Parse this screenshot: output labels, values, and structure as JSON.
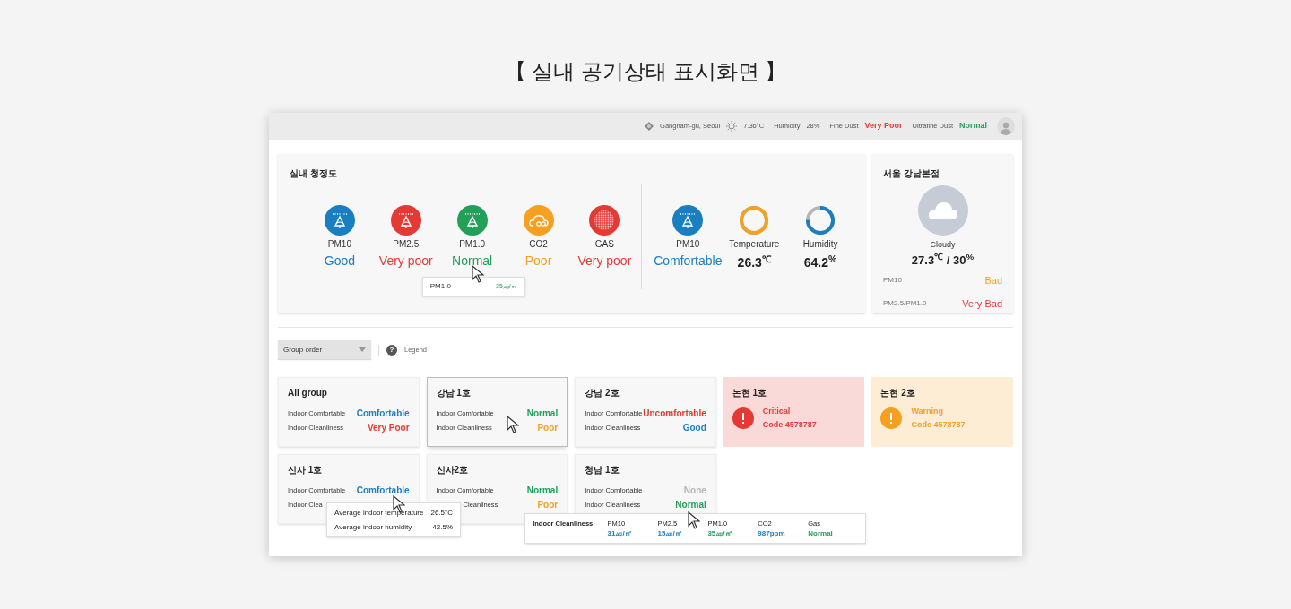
{
  "page_title": "【 실내 공기상태 표시화면 】",
  "top_bar": {
    "location": "Gangnam-gu, Seoul",
    "temperature": "7.36°C",
    "humidity_label": "Humidity",
    "humidity": "28%",
    "fine_dust_label": "Fine Dust",
    "fine_dust": {
      "value": "Very Poor",
      "color": "#e53935"
    },
    "ultrafine_label": "Ultrafine Dust",
    "ultrafine": {
      "value": "Normal",
      "color": "#22a05a"
    }
  },
  "cleanliness_panel": {
    "title": "실내 청정도",
    "sensors": [
      {
        "kind": "dust",
        "label": "PM10",
        "value": "Good",
        "color": "#1a7fc1"
      },
      {
        "kind": "dust",
        "label": "PM2.5",
        "value": "Very poor",
        "color": "#e53935"
      },
      {
        "kind": "dust",
        "label": "PM1.0",
        "value": "Normal",
        "color": "#22a05a",
        "tooltip": {
          "label": "PM1.0",
          "value": "35㎍/㎥"
        }
      },
      {
        "kind": "co2",
        "label": "CO2",
        "value": "Poor",
        "color": "#f5a020"
      },
      {
        "kind": "gas",
        "label": "GAS",
        "value": "Very poor",
        "color": "#e53935"
      }
    ],
    "comfort": [
      {
        "kind": "dust",
        "label": "PM10",
        "value": "Comfortable",
        "color": "#1a7fc1"
      },
      {
        "kind": "ring",
        "label": "Temperature",
        "value": "26.3$^{℃}$",
        "level": 1,
        "color": "#f5a020"
      },
      {
        "kind": "ring",
        "label": "Humidity",
        "value": "64.2$^{%}$",
        "level": 0.75,
        "color": "#1a7fc1"
      }
    ]
  },
  "weather_card": {
    "title": "서울 강남본점",
    "condition": "Cloudy",
    "reading": "27.3$^{℃}$ / 30$^{%}$",
    "rows": [
      {
        "label": "PM10",
        "value": "Bad",
        "color": "#f5a020"
      },
      {
        "label": "PM2.5/PM1.0",
        "value": "Very Bad",
        "color": "#e53935"
      }
    ]
  },
  "toolbar": {
    "sort_dropdown": "Group order",
    "legend_icon": "?",
    "legend": "Legend"
  },
  "groups": [
    {
      "kind": "status",
      "name": "All group",
      "selected": false,
      "rows": [
        {
          "label": "Indoor Comfortable",
          "value": "Comfortable",
          "color": "#1a7fc1"
        },
        {
          "label": "Indoor Cleanliness",
          "value": "Very Poor",
          "color": "#e53935"
        }
      ]
    },
    {
      "kind": "status",
      "name": "강남 1호",
      "selected": true,
      "rows": [
        {
          "label": "Indoor Comfortable",
          "value": "Normal",
          "color": "#22a05a"
        },
        {
          "label": "Indoor Cleanliness",
          "value": "Poor",
          "color": "#f5a020"
        }
      ]
    },
    {
      "kind": "status",
      "name": "강남 2호",
      "selected": false,
      "rows": [
        {
          "label": "Indoor Comfortable",
          "value": "Uncomfortable",
          "color": "#e53935"
        },
        {
          "label": "Indoor Cleanliness",
          "value": "Good",
          "color": "#1a7fc1"
        }
      ]
    },
    {
      "kind": "alert",
      "name": "논현 1호",
      "color": "#e53935",
      "lines": [
        "Critical",
        "Code 4578787"
      ]
    },
    {
      "kind": "alert",
      "name": "논현 2호",
      "color": "#f5a020",
      "lines": [
        "Warning",
        "Code 4578787"
      ]
    },
    {
      "kind": "status",
      "name": "신사 1호",
      "selected": false,
      "rows": [
        {
          "label": "Indoor Comfortable",
          "value": "Comfortable",
          "color": "#1a7fc1"
        },
        {
          "label": "Indoor Clea"
        }
      ],
      "tooltip": {
        "kind": "comfort",
        "rows": [
          {
            "label": "Average indoor temperature",
            "value": "26.5°C"
          },
          {
            "label": "Average indoor humidity",
            "value": "42.5%"
          }
        ]
      }
    },
    {
      "kind": "status",
      "name": "신사2호",
      "selected": false,
      "rows": [
        {
          "label": "Indoor Comfortable",
          "value": "Normal",
          "color": "#22a05a"
        },
        {
          "label": "Cleanliness",
          "value": "Poor",
          "color": "#f5a020",
          "covered_left": true
        }
      ]
    },
    {
      "kind": "status",
      "name": "청담 1호",
      "selected": false,
      "rows": [
        {
          "label": "Indoor Comfortable",
          "value": "None",
          "color": "#b5b5b5"
        },
        {
          "label": "Indoor Cleanliness",
          "value": "Normal",
          "color": "#22a05a"
        }
      ],
      "tooltip": {
        "kind": "cleanliness",
        "title": "Indoor Cleanliness",
        "items": [
          {
            "label": "PM10",
            "value": "31㎍/㎥",
            "color": "#1a7fc1"
          },
          {
            "label": "PM2.5",
            "value": "15㎍/㎥",
            "color": "#1a7fc1"
          },
          {
            "label": "PM1.0",
            "value": "35㎍/㎥",
            "color": "#22a05a"
          },
          {
            "label": "CO2",
            "value": "987ppm",
            "color": "#1a7fc1"
          },
          {
            "label": "Gas",
            "value": "Normal",
            "color": "#22a05a"
          }
        ]
      }
    }
  ]
}
